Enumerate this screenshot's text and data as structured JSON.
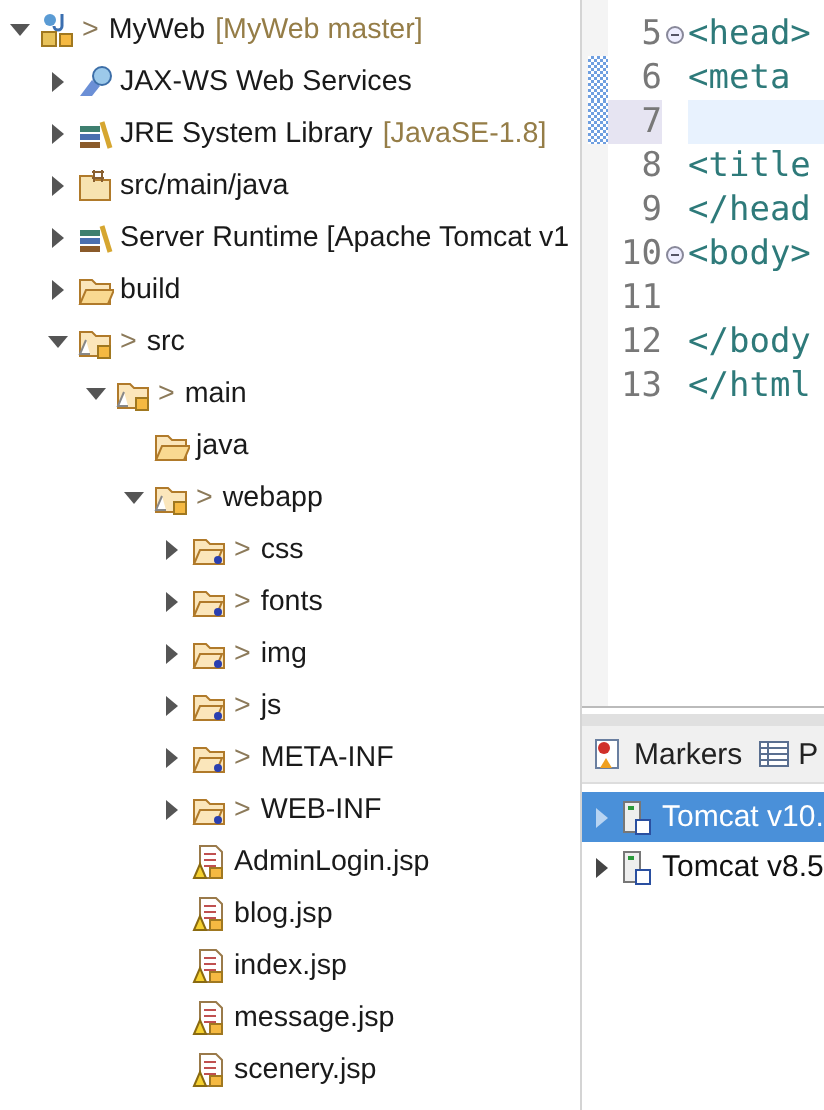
{
  "project_tree": {
    "items": [
      {
        "kind": "project",
        "prefix": ">",
        "label": "MyWeb",
        "decoration": "[MyWeb master]",
        "expanded": true,
        "children": [
          {
            "kind": "webservice",
            "label": "JAX-WS Web Services",
            "expanded": false
          },
          {
            "kind": "library",
            "label": "JRE System Library",
            "decoration": "[JavaSE-1.8]",
            "expanded": false
          },
          {
            "kind": "source-folder",
            "label": "src/main/java",
            "expanded": false
          },
          {
            "kind": "library",
            "label": "Server Runtime [Apache Tomcat v1",
            "expanded": false
          },
          {
            "kind": "folder",
            "label": "build",
            "expanded": false
          },
          {
            "kind": "tracked-folder",
            "prefix": ">",
            "label": "src",
            "expanded": true,
            "children": [
              {
                "kind": "tracked-folder",
                "prefix": ">",
                "label": "main",
                "expanded": true,
                "children": [
                  {
                    "kind": "folder",
                    "label": "java"
                  },
                  {
                    "kind": "tracked-folder",
                    "prefix": ">",
                    "label": "webapp",
                    "expanded": true,
                    "children": [
                      {
                        "kind": "untracked-folder",
                        "prefix": ">",
                        "label": "css",
                        "expanded": false
                      },
                      {
                        "kind": "untracked-folder",
                        "prefix": ">",
                        "label": "fonts",
                        "expanded": false
                      },
                      {
                        "kind": "untracked-folder",
                        "prefix": ">",
                        "label": "img",
                        "expanded": false
                      },
                      {
                        "kind": "untracked-folder",
                        "prefix": ">",
                        "label": "js",
                        "expanded": false
                      },
                      {
                        "kind": "untracked-folder",
                        "prefix": ">",
                        "label": "META-INF",
                        "expanded": false
                      },
                      {
                        "kind": "untracked-folder",
                        "prefix": ">",
                        "label": "WEB-INF",
                        "expanded": false
                      },
                      {
                        "kind": "jsp",
                        "label": "AdminLogin.jsp"
                      },
                      {
                        "kind": "jsp",
                        "label": "blog.jsp"
                      },
                      {
                        "kind": "jsp",
                        "label": "index.jsp"
                      },
                      {
                        "kind": "jsp",
                        "label": "message.jsp"
                      },
                      {
                        "kind": "jsp",
                        "label": "scenery.jsp"
                      }
                    ]
                  }
                ]
              }
            ]
          }
        ]
      }
    ]
  },
  "editor": {
    "lines": [
      {
        "number": "5",
        "code": "<head>",
        "foldable": true,
        "current": false,
        "changed": false
      },
      {
        "number": "6",
        "code": "<meta",
        "foldable": false,
        "current": false,
        "changed": true
      },
      {
        "number": "7",
        "foldable": false,
        "current": true,
        "changed": true
      },
      {
        "number": "8",
        "code": "<title",
        "foldable": false,
        "current": false,
        "changed": false
      },
      {
        "number": "9",
        "code": "</head",
        "foldable": false,
        "current": false,
        "changed": false
      },
      {
        "number": "10",
        "code": "<body>",
        "foldable": true,
        "current": false,
        "changed": false
      },
      {
        "number": "11",
        "foldable": false,
        "current": false,
        "changed": false
      },
      {
        "number": "12",
        "code": "</body",
        "foldable": false,
        "current": false,
        "changed": false
      },
      {
        "number": "13",
        "code": "</html",
        "foldable": false,
        "current": false,
        "changed": false
      }
    ]
  },
  "bottom_panel": {
    "tabs": [
      {
        "kind": "markers",
        "label": "Markers"
      },
      {
        "kind": "table",
        "label": "P"
      }
    ],
    "servers": [
      {
        "label": "Tomcat v10.",
        "selected": true,
        "expanded": false
      },
      {
        "label": "Tomcat v8.5",
        "selected": false,
        "expanded": false
      }
    ]
  }
}
